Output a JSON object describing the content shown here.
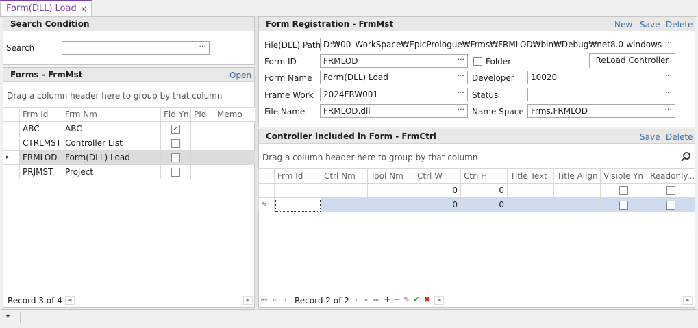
{
  "tab": {
    "title": "Form(DLL) Load",
    "close": "×"
  },
  "search": {
    "title": "Search Condition",
    "label": "Search",
    "value": ""
  },
  "forms": {
    "title": "Forms - FrmMst",
    "open_label": "Open",
    "group_hint": "Drag a column header here to group by that column",
    "columns": [
      "Frm Id",
      "Frm Nm",
      "Fld Yn",
      "PId",
      "Memo"
    ],
    "rows": [
      {
        "id": "ABC",
        "nm": "ABC",
        "fld": "✓"
      },
      {
        "id": "CTRLMST",
        "nm": "Controller List",
        "fld": ""
      },
      {
        "id": "FRMLOD",
        "nm": "Form(DLL) Load",
        "fld": ""
      },
      {
        "id": "PRJMST",
        "nm": "Project",
        "fld": ""
      }
    ],
    "record": "Record 3 of 4"
  },
  "reg": {
    "title": "Form Registration - FrmMst",
    "new_label": "New",
    "save_label": "Save",
    "delete_label": "Delete",
    "file_dll_path_label": "File(DLL) Path",
    "file_dll_path": "D:₩00_WorkSpace₩EpicPrologue₩Frms₩FRMLOD₩bin₩Debug₩net8.0-windows",
    "form_id_label": "Form ID",
    "form_id": "FRMLOD",
    "folder_label": "Folder",
    "reload_label": "ReLoad Controller",
    "form_name_label": "Form Name",
    "form_name": "Form(DLL) Load",
    "developer_label": "Developer",
    "developer": "10020",
    "framework_label": "Frame Work",
    "framework": "2024FRW001",
    "status_label": "Status",
    "status": "",
    "file_name_label": "File Name",
    "file_name": "FRMLOD.dll",
    "namespace_label": "Name Space",
    "namespace": "Frms.FRMLOD"
  },
  "ctrl": {
    "title": "Controller included in Form - FrmCtrl",
    "save_label": "Save",
    "delete_label": "Delete",
    "group_hint": "Drag a column header here to group by that column",
    "columns": [
      "Frm Id",
      "Ctrl Nm",
      "Tool Nm",
      "Ctrl W",
      "Ctrl H",
      "Title Text",
      "Title Align",
      "Visible Yn",
      "Readonly..."
    ],
    "rows": [
      {
        "w": "0",
        "h": "0"
      },
      {
        "w": "0",
        "h": "0"
      }
    ],
    "record": "Record 2 of 2"
  },
  "status_bar": {
    "dropdown": "▾"
  }
}
